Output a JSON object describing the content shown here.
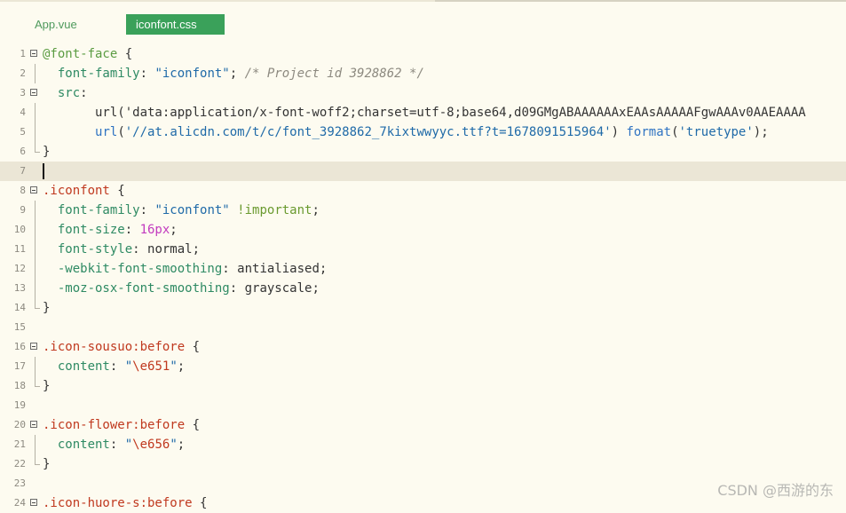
{
  "tabs": [
    {
      "label": "App.vue",
      "active": false
    },
    {
      "label": "iconfont.css",
      "active": true
    }
  ],
  "lines": [
    {
      "n": "1",
      "fold": true,
      "guide": false,
      "tokens": [
        [
          "kw",
          "@font-face"
        ],
        [
          "txt",
          " {"
        ]
      ]
    },
    {
      "n": "2",
      "fold": false,
      "guide": true,
      "tokens": [
        [
          "txt",
          "  "
        ],
        [
          "prop",
          "font-family"
        ],
        [
          "txt",
          ": "
        ],
        [
          "str",
          "\"iconfont\""
        ],
        [
          "txt",
          "; "
        ],
        [
          "cmt",
          "/* Project id 3928862 */"
        ]
      ]
    },
    {
      "n": "3",
      "fold": true,
      "guide": false,
      "tokens": [
        [
          "txt",
          "  "
        ],
        [
          "prop",
          "src"
        ],
        [
          "txt",
          ":"
        ]
      ]
    },
    {
      "n": "4",
      "fold": false,
      "guide": true,
      "tokens": [
        [
          "txt",
          "       url('data:application/x-font-woff2;charset=utf-8;base64,d09GMgABAAAAAAxEAAsAAAAAFgwAAAv0AAEAAAA"
        ]
      ]
    },
    {
      "n": "5",
      "fold": false,
      "guide": true,
      "tokens": [
        [
          "txt",
          "       "
        ],
        [
          "fn",
          "url"
        ],
        [
          "txt",
          "("
        ],
        [
          "str",
          "'//at.alicdn.com/t/c/font_3928862_7kixtwwyyc.ttf?t=1678091515964'"
        ],
        [
          "txt",
          ") "
        ],
        [
          "fn",
          "format"
        ],
        [
          "txt",
          "("
        ],
        [
          "str",
          "'truetype'"
        ],
        [
          "txt",
          ");"
        ]
      ]
    },
    {
      "n": "6",
      "fold": false,
      "guide": "end",
      "tokens": [
        [
          "txt",
          "}"
        ]
      ]
    },
    {
      "n": "7",
      "fold": false,
      "guide": false,
      "current": true,
      "tokens": []
    },
    {
      "n": "8",
      "fold": true,
      "guide": false,
      "tokens": [
        [
          "sel",
          ".iconfont"
        ],
        [
          "txt",
          " {"
        ]
      ]
    },
    {
      "n": "9",
      "fold": false,
      "guide": true,
      "tokens": [
        [
          "txt",
          "  "
        ],
        [
          "prop",
          "font-family"
        ],
        [
          "txt",
          ": "
        ],
        [
          "str",
          "\"iconfont\""
        ],
        [
          "txt",
          " "
        ],
        [
          "imp",
          "!important"
        ],
        [
          "txt",
          ";"
        ]
      ]
    },
    {
      "n": "10",
      "fold": false,
      "guide": true,
      "tokens": [
        [
          "txt",
          "  "
        ],
        [
          "prop",
          "font-size"
        ],
        [
          "txt",
          ": "
        ],
        [
          "num",
          "16px"
        ],
        [
          "txt",
          ";"
        ]
      ]
    },
    {
      "n": "11",
      "fold": false,
      "guide": true,
      "tokens": [
        [
          "txt",
          "  "
        ],
        [
          "prop",
          "font-style"
        ],
        [
          "txt",
          ": normal;"
        ]
      ]
    },
    {
      "n": "12",
      "fold": false,
      "guide": true,
      "tokens": [
        [
          "txt",
          "  "
        ],
        [
          "prop",
          "-webkit-font-smoothing"
        ],
        [
          "txt",
          ": antialiased;"
        ]
      ]
    },
    {
      "n": "13",
      "fold": false,
      "guide": true,
      "tokens": [
        [
          "txt",
          "  "
        ],
        [
          "prop",
          "-moz-osx-font-smoothing"
        ],
        [
          "txt",
          ": grayscale;"
        ]
      ]
    },
    {
      "n": "14",
      "fold": false,
      "guide": "end",
      "tokens": [
        [
          "txt",
          "}"
        ]
      ]
    },
    {
      "n": "15",
      "fold": false,
      "guide": false,
      "tokens": []
    },
    {
      "n": "16",
      "fold": true,
      "guide": false,
      "tokens": [
        [
          "sel",
          ".icon-sousuo:before"
        ],
        [
          "txt",
          " {"
        ]
      ]
    },
    {
      "n": "17",
      "fold": false,
      "guide": true,
      "tokens": [
        [
          "txt",
          "  "
        ],
        [
          "prop",
          "content"
        ],
        [
          "txt",
          ": "
        ],
        [
          "str",
          "\""
        ],
        [
          "sel",
          "\\e651"
        ],
        [
          "str",
          "\""
        ],
        [
          "txt",
          ";"
        ]
      ]
    },
    {
      "n": "18",
      "fold": false,
      "guide": "end",
      "tokens": [
        [
          "txt",
          "}"
        ]
      ]
    },
    {
      "n": "19",
      "fold": false,
      "guide": false,
      "tokens": []
    },
    {
      "n": "20",
      "fold": true,
      "guide": false,
      "tokens": [
        [
          "sel",
          ".icon-flower:before"
        ],
        [
          "txt",
          " {"
        ]
      ]
    },
    {
      "n": "21",
      "fold": false,
      "guide": true,
      "tokens": [
        [
          "txt",
          "  "
        ],
        [
          "prop",
          "content"
        ],
        [
          "txt",
          ": "
        ],
        [
          "str",
          "\""
        ],
        [
          "sel",
          "\\e656"
        ],
        [
          "str",
          "\""
        ],
        [
          "txt",
          ";"
        ]
      ]
    },
    {
      "n": "22",
      "fold": false,
      "guide": "end",
      "tokens": [
        [
          "txt",
          "}"
        ]
      ]
    },
    {
      "n": "23",
      "fold": false,
      "guide": false,
      "tokens": []
    },
    {
      "n": "24",
      "fold": true,
      "guide": false,
      "tokens": [
        [
          "sel",
          ".icon-huore-s:before"
        ],
        [
          "txt",
          " {"
        ]
      ]
    }
  ],
  "watermark": "CSDN @西游的东"
}
